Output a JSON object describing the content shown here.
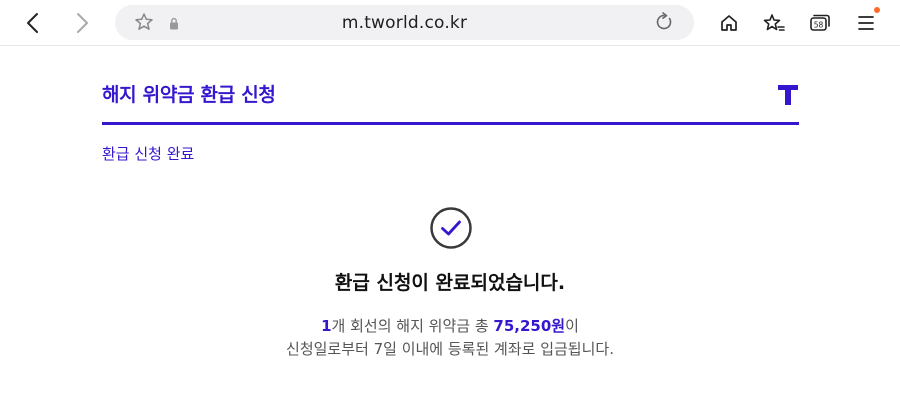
{
  "browser": {
    "url": "m.tworld.co.kr",
    "tab_count": "58",
    "accent": "#ff6a2b"
  },
  "page": {
    "title": "해지 위약금 환급 신청",
    "subtitle": "환급 신청 완료",
    "logo_text": "T",
    "brand_color": "#3617ce"
  },
  "result": {
    "heading": "환급 신청이 완료되었습니다.",
    "line1_count": "1",
    "line1_mid": "개 회선의 해지 위약금 총 ",
    "line1_amount": "75,250원",
    "line1_end": "이",
    "line2": "신청일로부터 7일 이내에 등록된 계좌로 입금됩니다."
  },
  "icons": [
    "back-icon",
    "forward-icon",
    "bookmark-star-icon",
    "lock-icon",
    "reload-icon",
    "home-icon",
    "favorites-icon",
    "tabs-icon",
    "menu-icon",
    "check-circle-icon"
  ]
}
